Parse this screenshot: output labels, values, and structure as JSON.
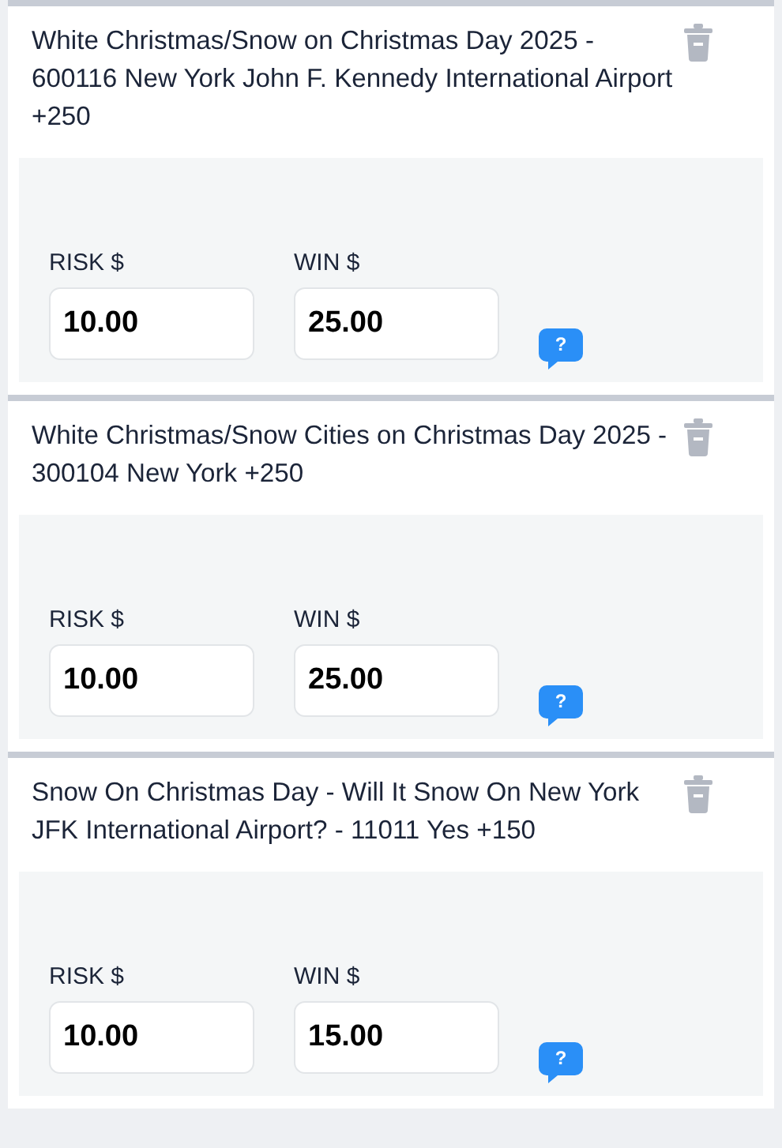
{
  "bets": [
    {
      "title": "White Christmas/Snow on Christmas Day 2025 - 600116 New York John F. Kennedy International Airport +250",
      "risk_label": "RISK $",
      "risk": "10.00",
      "win_label": "WIN $",
      "win": "25.00",
      "help": "?"
    },
    {
      "title": "White Christmas/Snow Cities on Christmas Day 2025 - 300104 New York +250",
      "risk_label": "RISK $",
      "risk": "10.00",
      "win_label": "WIN $",
      "win": "25.00",
      "help": "?"
    },
    {
      "title": "Snow On Christmas Day - Will It Snow On New York JFK International Airport? - 11011 Yes +150",
      "risk_label": "RISK $",
      "risk": "10.00",
      "win_label": "WIN $",
      "win": "15.00",
      "help": "?"
    }
  ]
}
